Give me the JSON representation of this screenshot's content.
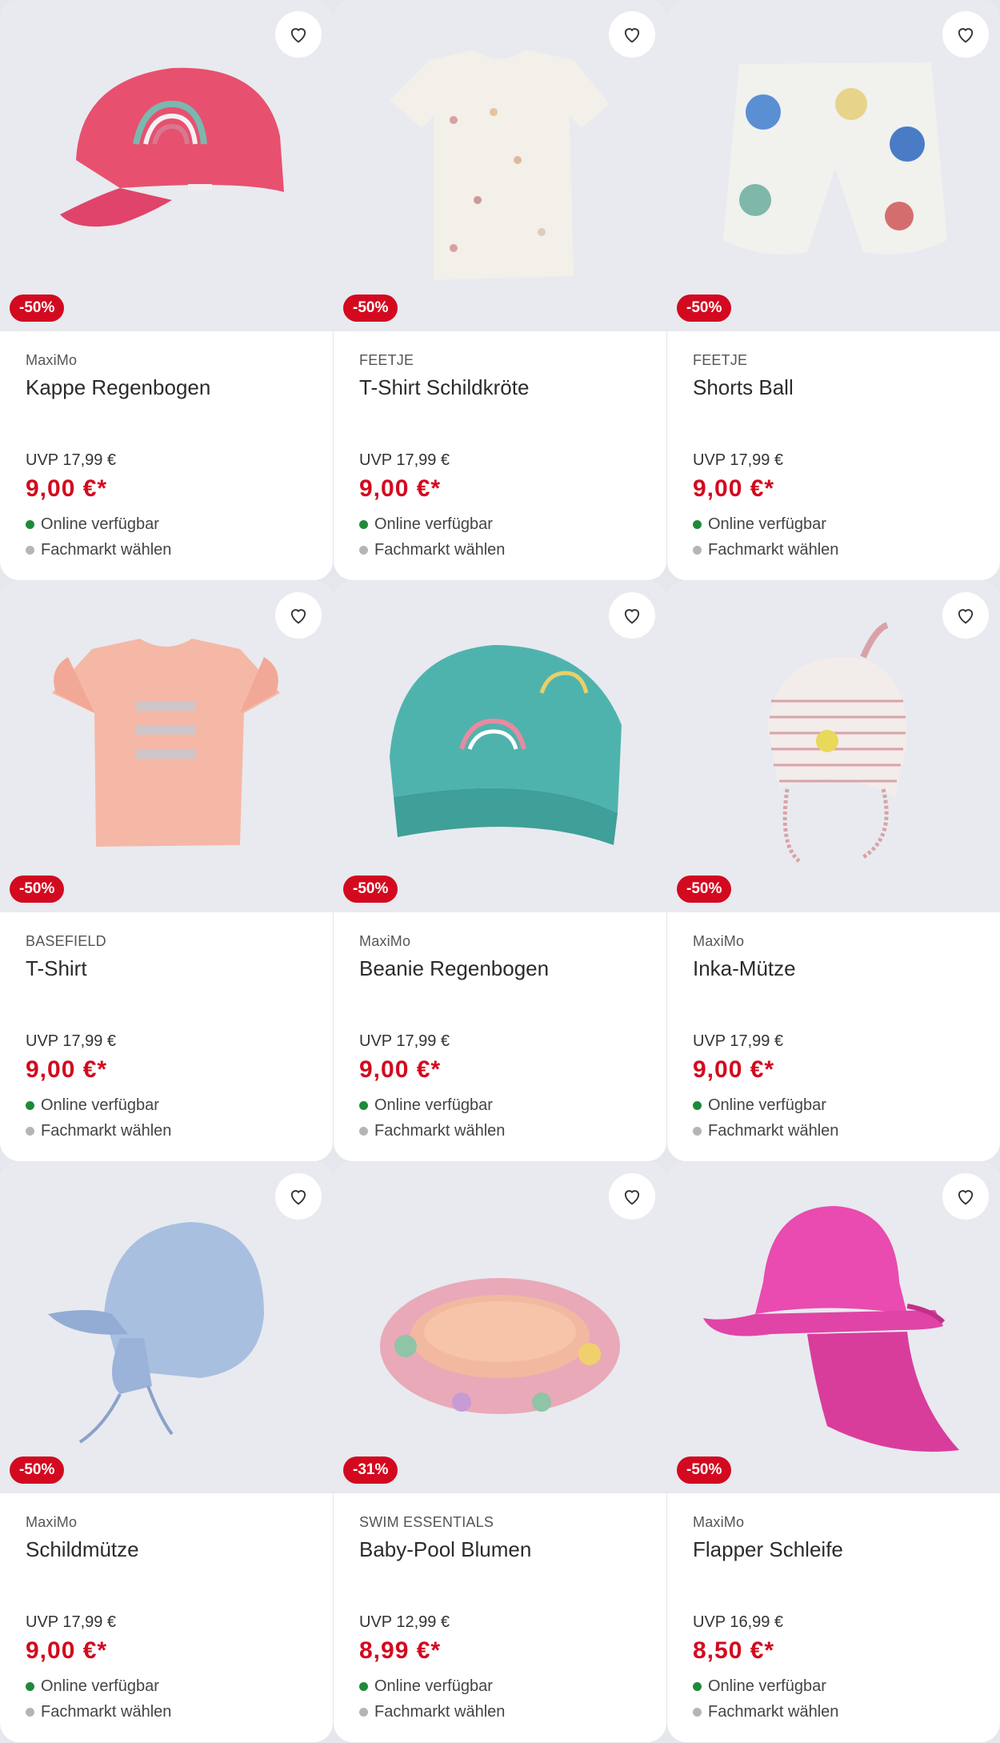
{
  "colors": {
    "sale_red": "#d3091f",
    "online_dot": "#1f8a3a",
    "store_dot": "#b5b5b5",
    "image_bg": "#e8eaef"
  },
  "products": [
    {
      "brand": "MaxiMo",
      "name": "Kappe Regenbogen",
      "badge": "-50%",
      "uvp": "UVP 17,99 €",
      "price": "9,00 €*",
      "online": "Online verfügbar",
      "store": "Fachmarkt wählen",
      "icon": "pink-cap-icon"
    },
    {
      "brand": "FEETJE",
      "name": "T-Shirt Schildkröte",
      "badge": "-50%",
      "uvp": "UVP 17,99 €",
      "price": "9,00 €*",
      "online": "Online verfügbar",
      "store": "Fachmarkt wählen",
      "icon": "tshirt-icon"
    },
    {
      "brand": "FEETJE",
      "name": "Shorts Ball",
      "badge": "-50%",
      "uvp": "UVP 17,99 €",
      "price": "9,00 €*",
      "online": "Online verfügbar",
      "store": "Fachmarkt wählen",
      "icon": "shorts-icon"
    },
    {
      "brand": "BASEFIELD",
      "name": "T-Shirt",
      "badge": "-50%",
      "uvp": "UVP 17,99 €",
      "price": "9,00 €*",
      "online": "Online verfügbar",
      "store": "Fachmarkt wählen",
      "icon": "tshirt-icon"
    },
    {
      "brand": "MaxiMo",
      "name": "Beanie Regenbogen",
      "badge": "-50%",
      "uvp": "UVP 17,99 €",
      "price": "9,00 €*",
      "online": "Online verfügbar",
      "store": "Fachmarkt wählen",
      "icon": "beanie-icon"
    },
    {
      "brand": "MaxiMo",
      "name": "Inka-Mütze",
      "badge": "-50%",
      "uvp": "UVP 17,99 €",
      "price": "9,00 €*",
      "online": "Online verfügbar",
      "store": "Fachmarkt wählen",
      "icon": "inka-hat-icon"
    },
    {
      "brand": "MaxiMo",
      "name": "Schildmütze",
      "badge": "-50%",
      "uvp": "UVP 17,99 €",
      "price": "9,00 €*",
      "online": "Online verfügbar",
      "store": "Fachmarkt wählen",
      "icon": "peaked-cap-icon"
    },
    {
      "brand": "SWIM ESSENTIALS",
      "name": "Baby-Pool Blumen",
      "badge": "-31%",
      "uvp": "UVP 12,99 €",
      "price": "8,99 €*",
      "online": "Online verfügbar",
      "store": "Fachmarkt wählen",
      "icon": "pool-icon"
    },
    {
      "brand": "MaxiMo",
      "name": "Flapper Schleife",
      "badge": "-50%",
      "uvp": "UVP 16,99 €",
      "price": "8,50 €*",
      "online": "Online verfügbar",
      "store": "Fachmarkt wählen",
      "icon": "sun-hat-icon"
    }
  ]
}
